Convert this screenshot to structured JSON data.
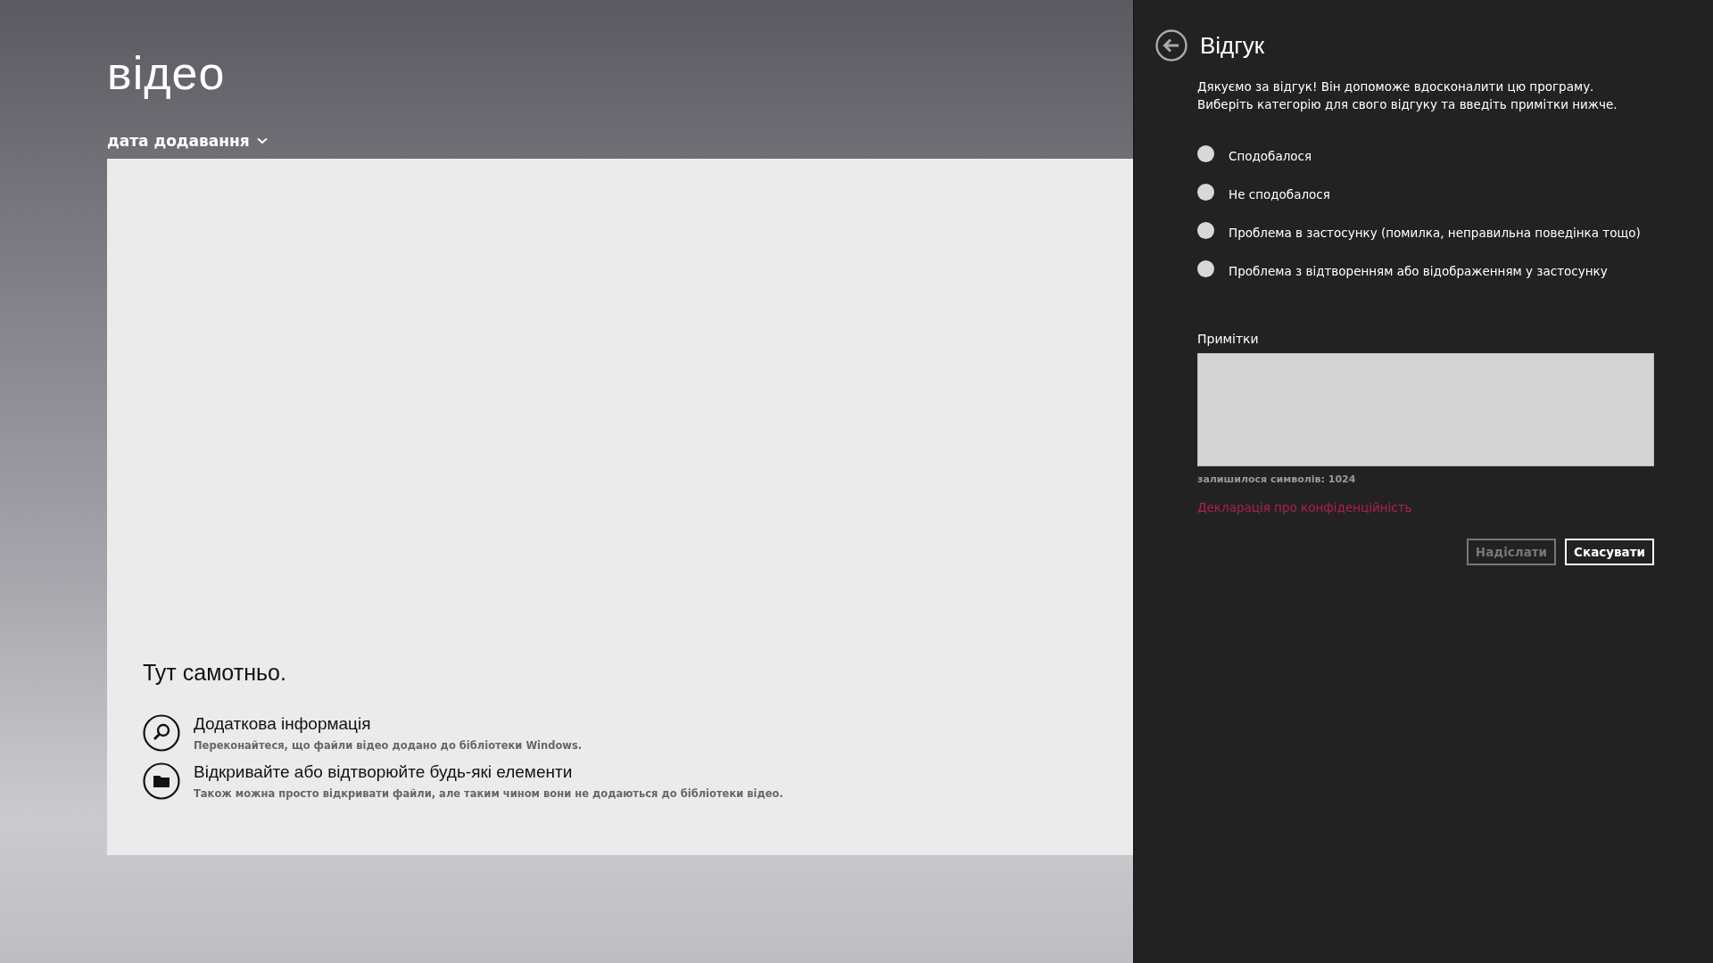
{
  "app": {
    "title": "відео",
    "sort": {
      "label": "дата додавання"
    },
    "empty": {
      "heading": "Тут самотньо.",
      "items": [
        {
          "kind": "search",
          "title": "Додаткова інформація",
          "description": "Переконайтеся, що файли відео додано до бібліотеки Windows."
        },
        {
          "kind": "folder",
          "title": "Відкривайте або відтворюйте будь-які елементи",
          "description": "Також можна просто відкривати файли, але таким чином вони не додаються до бібліотеки відео."
        }
      ]
    }
  },
  "feedback_panel": {
    "title": "Відгук",
    "intro": [
      "Дякуємо за відгук! Він допоможе вдосконалити цю програму.",
      "Виберіть категорію для свого відгуку та введіть примітки нижче."
    ],
    "options": [
      {
        "label": "Сподобалося",
        "selected": false
      },
      {
        "label": "Не сподобалося",
        "selected": false
      },
      {
        "label": "Проблема в застосунку (помилка, неправильна поведінка тощо)",
        "selected": false
      },
      {
        "label": "Проблема з відтворенням або відображенням у застосунку",
        "selected": false
      }
    ],
    "notes": {
      "label": "Примітки",
      "counter": "залишилося символів: 1024"
    },
    "privacy_link": "Декларація про конфіденційність",
    "buttons": [
      {
        "label": "Надіслати",
        "disabled": true
      },
      {
        "label": "Скасувати",
        "disabled": false
      }
    ]
  }
}
